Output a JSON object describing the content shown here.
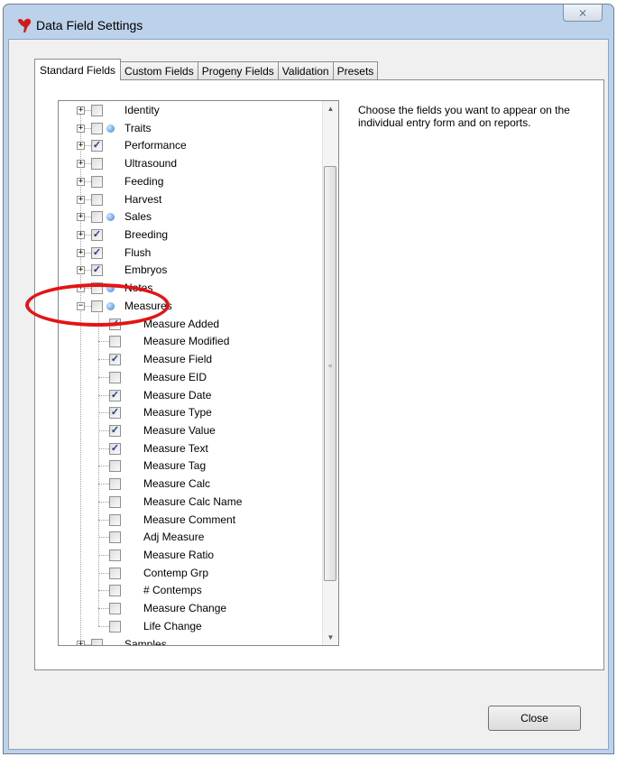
{
  "window": {
    "title": "Data Field Settings",
    "close_glyph": "⨯"
  },
  "tabs": [
    {
      "label": "Standard Fields",
      "active": true
    },
    {
      "label": "Custom Fields"
    },
    {
      "label": "Progeny Fields"
    },
    {
      "label": "Validation"
    },
    {
      "label": "Presets"
    }
  ],
  "tree": {
    "items": [
      {
        "label": "Identity",
        "level": 0,
        "expander": "+",
        "checked": false,
        "dot": false
      },
      {
        "label": "Traits",
        "level": 0,
        "expander": "+",
        "checked": false,
        "dot": true
      },
      {
        "label": "Performance",
        "level": 0,
        "expander": "+",
        "checked": true,
        "dot": false
      },
      {
        "label": "Ultrasound",
        "level": 0,
        "expander": "+",
        "checked": false,
        "dot": false
      },
      {
        "label": "Feeding",
        "level": 0,
        "expander": "+",
        "checked": false,
        "dot": false
      },
      {
        "label": "Harvest",
        "level": 0,
        "expander": "+",
        "checked": false,
        "dot": false
      },
      {
        "label": "Sales",
        "level": 0,
        "expander": "+",
        "checked": false,
        "dot": true
      },
      {
        "label": "Breeding",
        "level": 0,
        "expander": "+",
        "checked": true,
        "dot": false
      },
      {
        "label": "Flush",
        "level": 0,
        "expander": "+",
        "checked": true,
        "dot": false
      },
      {
        "label": "Embryos",
        "level": 0,
        "expander": "+",
        "checked": true,
        "dot": false
      },
      {
        "label": "Notes",
        "level": 0,
        "expander": "+",
        "checked": false,
        "dot": true
      },
      {
        "label": "Measures",
        "level": 0,
        "expander": "−",
        "checked": false,
        "dot": true
      },
      {
        "label": "Measure Added",
        "level": 1,
        "checked": true
      },
      {
        "label": "Measure Modified",
        "level": 1,
        "checked": false
      },
      {
        "label": "Measure Field",
        "level": 1,
        "checked": true
      },
      {
        "label": "Measure EID",
        "level": 1,
        "checked": false
      },
      {
        "label": "Measure Date",
        "level": 1,
        "checked": true
      },
      {
        "label": "Measure Type",
        "level": 1,
        "checked": true
      },
      {
        "label": "Measure Value",
        "level": 1,
        "checked": true
      },
      {
        "label": "Measure Text",
        "level": 1,
        "checked": true
      },
      {
        "label": "Measure Tag",
        "level": 1,
        "checked": false
      },
      {
        "label": "Measure Calc",
        "level": 1,
        "checked": false
      },
      {
        "label": "Measure Calc Name",
        "level": 1,
        "checked": false
      },
      {
        "label": "Measure Comment",
        "level": 1,
        "checked": false
      },
      {
        "label": "Adj Measure",
        "level": 1,
        "checked": false
      },
      {
        "label": "Measure Ratio",
        "level": 1,
        "checked": false
      },
      {
        "label": "Contemp Grp",
        "level": 1,
        "checked": false
      },
      {
        "label": "# Contemps",
        "level": 1,
        "checked": false
      },
      {
        "label": "Measure Change",
        "level": 1,
        "checked": false
      },
      {
        "label": "Life Change",
        "level": 1,
        "checked": false
      },
      {
        "label": "Samples",
        "level": 0,
        "expander": "+",
        "checked": false,
        "dot": false
      }
    ],
    "check_glyph": "✓",
    "scroll_position": 0.5
  },
  "help_text": "Choose the fields you want to appear on the individual entry form and on reports.",
  "buttons": {
    "close": "Close"
  },
  "colors": {
    "annotation": "#e41414",
    "node_dot": "#2f7fd6",
    "window_frame": "#bcd1ea"
  }
}
